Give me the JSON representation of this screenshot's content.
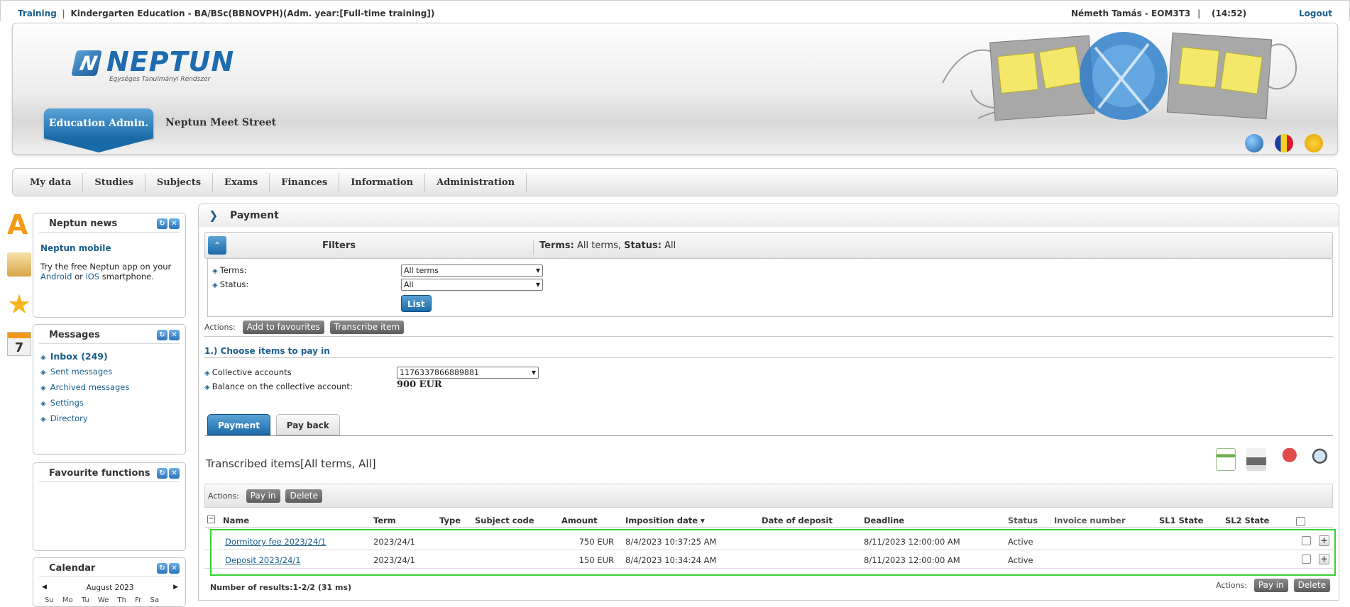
{
  "topbar": {
    "training": "Training",
    "separator": "|",
    "program": "Kindergarten Education - BA/BSc(BBNOVPH)(Adm. year:[Full-time training])",
    "user": "Németh Tamás - EOM3T3",
    "user_sep": "|",
    "time": "(14:52)",
    "logout": "Logout"
  },
  "header": {
    "logo_word": "NEPTUN",
    "logo_tagline": "Egységes Tanulmányi Rendszer",
    "edu_tab": "Education Admin.",
    "meet_street": "Neptun Meet Street"
  },
  "menu": [
    "My data",
    "Studies",
    "Subjects",
    "Exams",
    "Finances",
    "Information",
    "Administration"
  ],
  "side_icons": {
    "calendar_day": "7"
  },
  "news": {
    "title": "Neptun news",
    "subtitle": "Neptun mobile",
    "text_before": "Try the free Neptun app on your ",
    "android": "Android",
    "or": " or ",
    "ios": "iOS",
    "text_after": " smartphone."
  },
  "messages": {
    "title": "Messages",
    "items": [
      "Inbox (249)",
      "Sent messages",
      "Archived messages",
      "Settings",
      "Directory"
    ]
  },
  "favourites": {
    "title": "Favourite functions"
  },
  "calendar": {
    "title": "Calendar",
    "month": "August 2023",
    "days": "Su Mo Tu We Th Fr Sa"
  },
  "page": {
    "title": "Payment",
    "filters": {
      "label": "Filters",
      "summary_terms_label": "Terms:",
      "summary_terms_value": "All terms,",
      "summary_status_label": "Status:",
      "summary_status_value": "All",
      "terms_label": "Terms:",
      "terms_value": "All terms",
      "status_label": "Status:",
      "status_value": "All",
      "list_button": "List"
    },
    "actions_label": "Actions:",
    "action_buttons": [
      "Add to favourites",
      "Transcribe item"
    ],
    "section_title": "1.) Choose items to pay in",
    "collective_label": "Collective accounts",
    "collective_value": "1176337866889881",
    "balance_label": "Balance on the collective account:",
    "balance_value": "900 EUR",
    "tabs": [
      "Payment",
      "Pay back"
    ],
    "grid_title": "Transcribed items[All terms, All]",
    "grid_actions": [
      "Pay in",
      "Delete"
    ],
    "columns": {
      "name": "Name",
      "term": "Term",
      "type": "Type",
      "subject_code": "Subject code",
      "amount": "Amount",
      "imposition_date": "Imposition date",
      "date_of_deposit": "Date of deposit",
      "deadline": "Deadline",
      "status": "Status",
      "invoice_number": "Invoice number",
      "sl1_state": "SL1 State",
      "sl2_state": "SL2 State"
    },
    "rows": [
      {
        "name": "Dormitory fee 2023/24/1",
        "term": "2023/24/1",
        "amount": "750 EUR",
        "imposition_date": "8/4/2023 10:37:25 AM",
        "deadline": "8/11/2023 12:00:00 AM",
        "status": "Active"
      },
      {
        "name": "Deposit 2023/24/1",
        "term": "2023/24/1",
        "amount": "150 EUR",
        "imposition_date": "8/4/2023 10:34:24 AM",
        "deadline": "8/11/2023 12:00:00 AM",
        "status": "Active"
      }
    ],
    "results": "Number of results:1-2/2 (31 ms)",
    "bottom_actions_label": "Actions:",
    "bottom_actions": [
      "Pay in",
      "Delete"
    ]
  },
  "colors": {
    "accent_blue": "#1b6aa8",
    "link_blue": "#1a5e8c",
    "highlight_green": "#35d335"
  }
}
